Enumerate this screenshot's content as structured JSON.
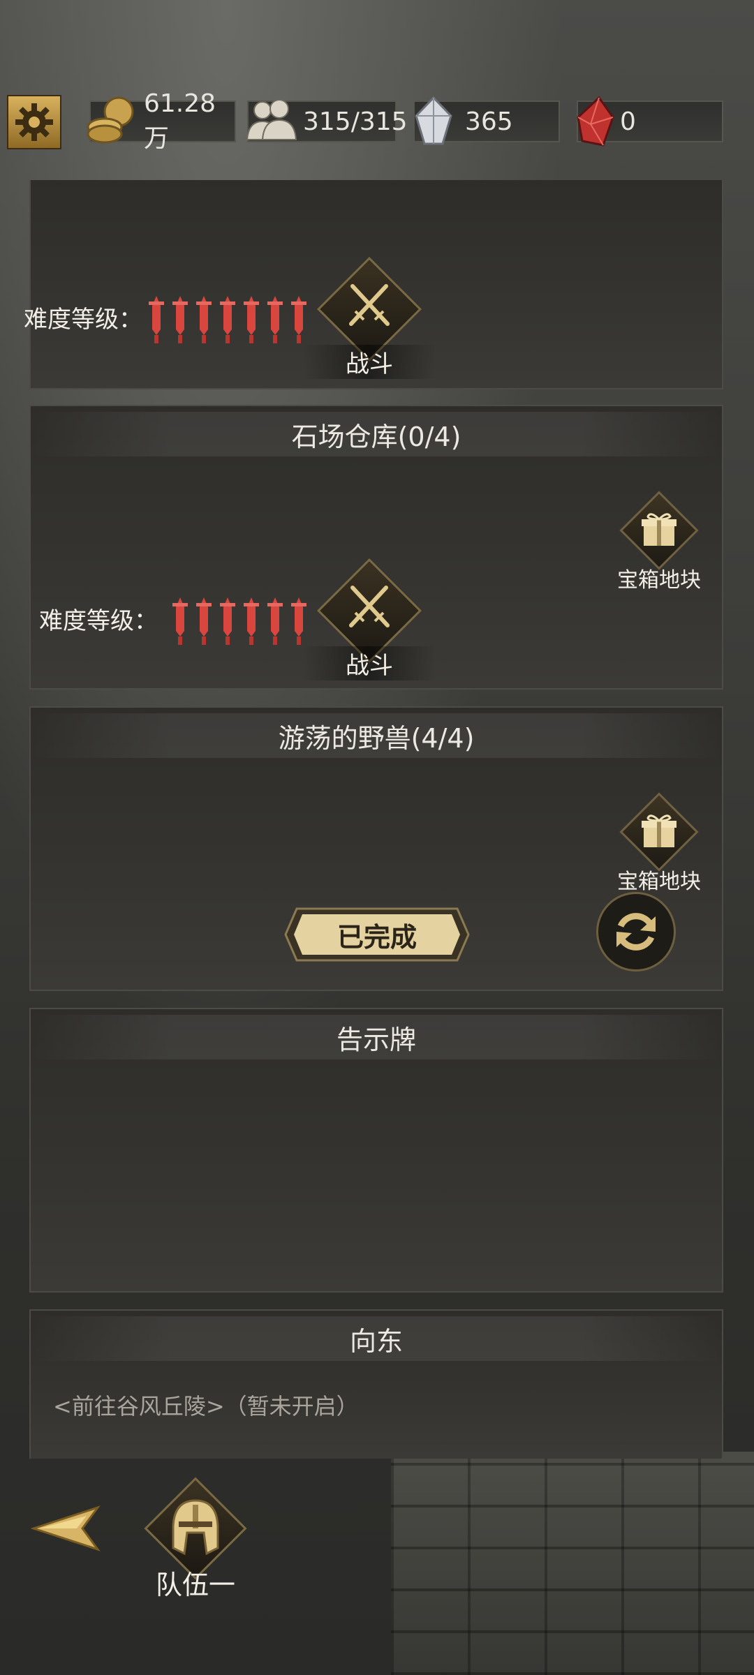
{
  "resources": {
    "gold": "61.28万",
    "population": "315/315",
    "crystal": "365",
    "ruby": "0"
  },
  "panels": [
    {
      "difficulty_label": "难度等级：",
      "battle_label": "战斗"
    },
    {
      "title": "石场仓库(0/4)",
      "chest_label": "宝箱地块",
      "difficulty_label": "难度等级：",
      "battle_label": "战斗"
    },
    {
      "title": "游荡的野兽(4/4)",
      "chest_label": "宝箱地块",
      "done_label": "已完成"
    },
    {
      "title": "告示牌"
    },
    {
      "title": "向东",
      "text": "<前往谷风丘陵>（暂未开启）"
    }
  ],
  "bottom": {
    "team_label": "队伍一"
  },
  "colors": {
    "gold_accent": "#d9b15e",
    "dagger_red": "#d9463e",
    "panel_bg": "#353430"
  },
  "icons": {
    "settings": "gear-icon",
    "gold": "coin-stack-icon",
    "population": "people-icon",
    "crystal": "crystal-icon",
    "ruby": "ruby-icon",
    "battle": "crossed-swords-icon",
    "chest": "gift-box-icon",
    "refresh": "refresh-icon",
    "back": "back-arrow-icon",
    "team": "helmet-icon"
  }
}
